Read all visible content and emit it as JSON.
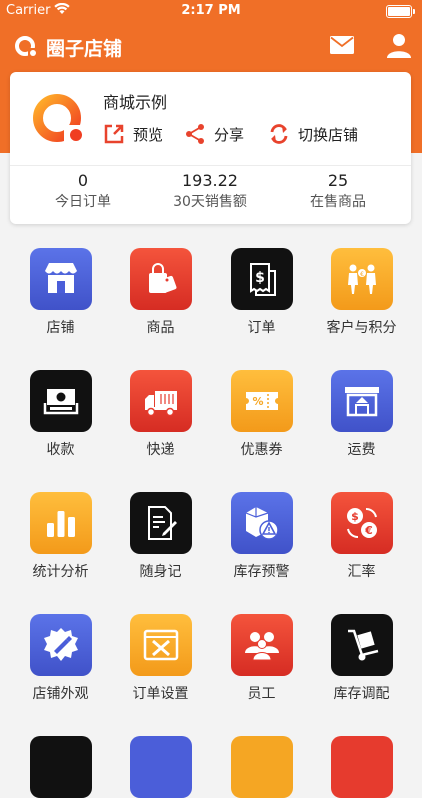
{
  "status_bar": {
    "carrier": "Carrier",
    "time": "2:17 PM"
  },
  "navbar": {
    "title": "圈子店铺",
    "icons": [
      "app-logo-icon",
      "mail-icon",
      "user-icon"
    ]
  },
  "shop_card": {
    "name": "商城示例",
    "actions": [
      {
        "label": "预览",
        "icon": "external-link-icon"
      },
      {
        "label": "分享",
        "icon": "share-icon"
      },
      {
        "label": "切换店铺",
        "icon": "switch-icon"
      }
    ],
    "stats": [
      {
        "value": "0",
        "label": "今日订单"
      },
      {
        "value": "193.22",
        "label": "30天销售额"
      },
      {
        "value": "25",
        "label": "在售商品"
      }
    ]
  },
  "grid": [
    {
      "label": "店铺",
      "icon": "store-icon",
      "color": "#4b5ed9"
    },
    {
      "label": "商品",
      "icon": "shopping-bag-icon",
      "color": "#e63b2e"
    },
    {
      "label": "订单",
      "icon": "receipt-icon",
      "color": "#111111"
    },
    {
      "label": "客户与积分",
      "icon": "customers-icon",
      "color": "#f5a623"
    },
    {
      "label": "收款",
      "icon": "cash-icon",
      "color": "#111111"
    },
    {
      "label": "快递",
      "icon": "truck-icon",
      "color": "#e63b2e"
    },
    {
      "label": "优惠券",
      "icon": "coupon-icon",
      "color": "#f5a623"
    },
    {
      "label": "运费",
      "icon": "warehouse-icon",
      "color": "#4b5ed9"
    },
    {
      "label": "统计分析",
      "icon": "bar-chart-icon",
      "color": "#f5a623"
    },
    {
      "label": "随身记",
      "icon": "note-icon",
      "color": "#111111"
    },
    {
      "label": "库存预警",
      "icon": "stock-alert-icon",
      "color": "#4b5ed9"
    },
    {
      "label": "汇率",
      "icon": "exchange-icon",
      "color": "#e63b2e"
    },
    {
      "label": "店铺外观",
      "icon": "appearance-icon",
      "color": "#4b5ed9"
    },
    {
      "label": "订单设置",
      "icon": "order-settings-icon",
      "color": "#f5a623"
    },
    {
      "label": "员工",
      "icon": "staff-icon",
      "color": "#e63b2e"
    },
    {
      "label": "库存调配",
      "icon": "hand-truck-icon",
      "color": "#111111"
    }
  ],
  "colors": {
    "brand": "#f06f27",
    "blue": "#4b5ed9",
    "red": "#e63b2e",
    "orange": "#f5a623",
    "black": "#111111"
  }
}
